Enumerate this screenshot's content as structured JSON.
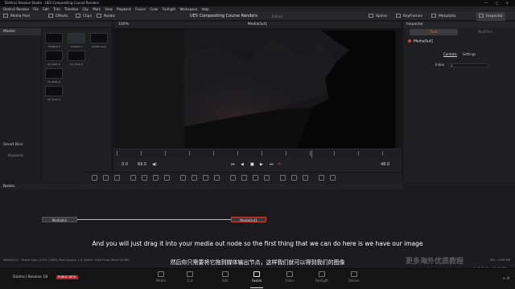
{
  "app": {
    "window_title": "DaVinci Resolve Studio - UE5 Compositing Course Renders",
    "window_controls": "— ▢ ✕"
  },
  "menu": [
    "DaVinci Resolve",
    "File",
    "Edit",
    "Trim",
    "Timeline",
    "Clip",
    "Mark",
    "View",
    "Playback",
    "Fusion",
    "Color",
    "Fairlight",
    "Workspace",
    "Help"
  ],
  "toolbar": {
    "media_pool": "Media Pool",
    "effects": "Effects",
    "clips": "Clips",
    "nodes": "Nodes",
    "project_title": "UE5 Compositing Course Renders",
    "project_status": "Edited",
    "spline": "Spline",
    "keyframes": "Keyframes",
    "metadata": "Metadata",
    "inspector": "Inspector"
  },
  "media_pool": {
    "master_label": "Master",
    "smart_bins_label": "Smart Bins",
    "keywords_label": "Keywords",
    "clips": [
      "Timeline 1",
      "Timeline 1",
      "Golden Gen",
      "CU_Shot_0",
      "CU_Shot_0",
      "CU_Shot_0",
      "CU_Shot_0"
    ]
  },
  "viewer": {
    "title": "MediaOut1",
    "zoom": "100%",
    "timecode_start": "0.0",
    "duration": "69.0",
    "current_frame": "48.0"
  },
  "inspector": {
    "title": "Inspector",
    "tab_video": "Tools",
    "tab_audio": "Modifiers",
    "node_name": "MediaOut1",
    "subtab_controls": "Controls",
    "subtab_settings": "Settings",
    "index_label": "Index",
    "index_value": "0"
  },
  "nodes_panel": {
    "title": "Nodes",
    "media_in": "MediaIn1",
    "media_out": "MediaOut1"
  },
  "subtitles": {
    "en": "And you will just drag it into your media out node so the first thing that we can do here is we have our image",
    "zh": "然后你只需要将它拖到媒体输出节点，这样我们就可以得到我们的图像"
  },
  "watermark": {
    "main": "更多海外优质教程",
    "url": "c g t g . c o m"
  },
  "status": {
    "left": "MediaOut1 - Frame Size: [1920, 1080], Pixel Aspect: 1.0, Depth: 32bit Float (Mem:32768)",
    "right": "8% - 2496 MB"
  },
  "pages": [
    "Media",
    "Cut",
    "Edit",
    "Fusion",
    "Color",
    "Fairlight",
    "Deliver"
  ],
  "active_page": "Fusion",
  "brand": {
    "name": "DaVinci Resolve 18",
    "badge": "PUBLIC BETA"
  },
  "colors": {
    "accent_red": "#c9423e",
    "link_yellow": "#e3c63a"
  }
}
